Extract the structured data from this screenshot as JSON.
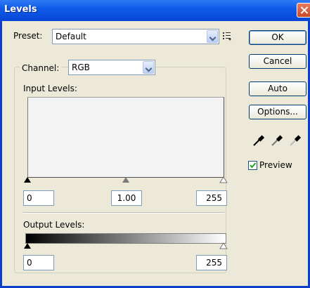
{
  "window": {
    "title": "Levels"
  },
  "preset": {
    "label": "Preset:",
    "value": "Default"
  },
  "channel": {
    "label": "Channel:",
    "value": "RGB"
  },
  "input_levels": {
    "label": "Input Levels:",
    "black": "0",
    "gamma": "1.00",
    "white": "255"
  },
  "output_levels": {
    "label": "Output Levels:",
    "black": "0",
    "white": "255"
  },
  "buttons": {
    "ok": "OK",
    "cancel": "Cancel",
    "auto": "Auto",
    "options": "Options..."
  },
  "preview": {
    "label": "Preview",
    "checked": true
  },
  "icons": [
    "preset-options-icon",
    "black-eyedropper-icon",
    "gray-eyedropper-icon",
    "white-eyedropper-icon"
  ]
}
